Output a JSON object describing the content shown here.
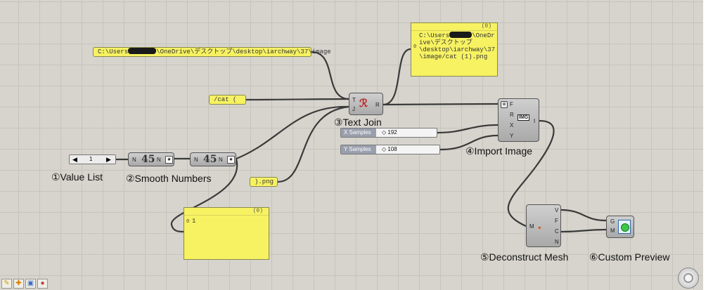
{
  "panels": {
    "path_text": {
      "pre": "C:\\Users",
      "post": "\\OneDrive\\デスクトップ\\desktop\\iarchway\\37\\image"
    },
    "prefix_text": "/cat (",
    "suffix_text": ").png",
    "output_panel": {
      "header": "(0)",
      "index": "0",
      "pre": "C:\\Users",
      "line1post": "\\OneDr",
      "lines": "ive\\デスクトップ\n\\desktop\\iarchway\\37\n\\image/cat (1).png"
    },
    "number_panel": {
      "header": "(0)",
      "index": "0",
      "value": "1"
    }
  },
  "value_list": {
    "value": "1"
  },
  "smooth1": {
    "in": "N",
    "out": "N",
    "glyph": "45"
  },
  "smooth2": {
    "in": "N",
    "out": "N",
    "glyph": "45"
  },
  "text_join": {
    "in1": "T",
    "in2": "J",
    "out": "R"
  },
  "sliders": [
    {
      "name": "X Samples",
      "value": "192"
    },
    {
      "name": "Y Samples",
      "value": "108"
    }
  ],
  "import_image": {
    "ports": [
      "F",
      "R",
      "X",
      "Y"
    ],
    "out": "I",
    "icon": "IMG"
  },
  "deconstruct_mesh": {
    "in": "M",
    "outs": [
      "V",
      "F",
      "C",
      "N"
    ]
  },
  "custom_preview": {
    "ins": [
      "G",
      "M"
    ]
  },
  "labels": {
    "value_list": "①Value List",
    "smooth": "②Smooth Numbers",
    "text_join": "③Text Join",
    "import_image": "④Import Image",
    "deconstruct": "⑤Deconstruct Mesh",
    "preview": "⑥Custom Preview"
  },
  "colors": {
    "panel": "#f7f262",
    "canvas": "#d6d4cd",
    "component": "#b9b9b9"
  }
}
